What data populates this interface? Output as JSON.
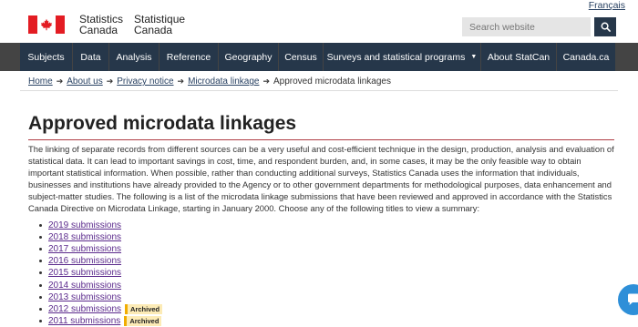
{
  "header": {
    "language_toggle": "Français",
    "wordmark": {
      "en_line1": "Statistics",
      "en_line2": "Canada",
      "fr_line1": "Statistique",
      "fr_line2": "Canada"
    },
    "search_placeholder": "Search website"
  },
  "menu": [
    {
      "label": "Subjects"
    },
    {
      "label": "Data"
    },
    {
      "label": "Analysis"
    },
    {
      "label": "Reference"
    },
    {
      "label": "Geography"
    },
    {
      "label": "Census"
    },
    {
      "label": "Surveys and statistical programs"
    },
    {
      "label": "About StatCan"
    },
    {
      "label": "Canada.ca"
    }
  ],
  "breadcrumb": [
    {
      "label": "Home"
    },
    {
      "label": "About us"
    },
    {
      "label": "Privacy notice"
    },
    {
      "label": "Microdata linkage"
    },
    {
      "label": "Approved microdata linkages"
    }
  ],
  "page": {
    "title": "Approved microdata linkages",
    "intro": "The linking of separate records from different sources can be a very useful and cost-efficient technique in the design, production, analysis and evaluation of statistical data. It can lead to important savings in cost, time, and respondent burden, and, in some cases, it may be the only feasible way to obtain important statistical information. When possible, rather than conducting additional surveys, Statistics Canada uses the information that individuals, businesses and institutions have already provided to the Agency or to other government departments for methodological purposes, data enhancement and subject-matter studies. The following is a list of the microdata linkage submissions that have been reviewed and approved in accordance with the Statistics Canada Directive on Microdata Linkage, starting in January 2000. Choose any of the following titles to view a summary:",
    "submissions": [
      {
        "label": "2019 submissions"
      },
      {
        "label": "2018 submissions"
      },
      {
        "label": "2017 submissions"
      },
      {
        "label": "2016 submissions"
      },
      {
        "label": "2015 submissions"
      },
      {
        "label": "2014 submissions"
      },
      {
        "label": "2013 submissions"
      },
      {
        "label": "2012 submissions",
        "badge": "Archived"
      },
      {
        "label": "2011 submissions",
        "badge": "Archived"
      }
    ]
  },
  "icons": {
    "search": "search-icon",
    "chat": "chat-icon",
    "caret": "chevron-down-icon",
    "flag": "canada-flag-icon"
  },
  "colors": {
    "nav_bg": "#26374a",
    "flag_red": "#e31c23",
    "title_rule": "#af3c43",
    "visited_link": "#5b2a8c",
    "badge_border": "#f0ad02"
  }
}
